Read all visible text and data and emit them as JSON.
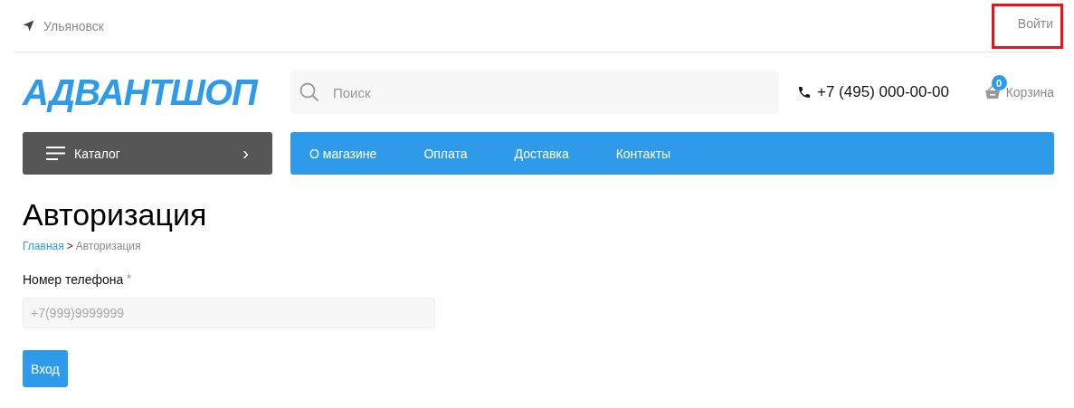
{
  "top_bar": {
    "city": "Ульяновск",
    "login": {
      "label": "Войти",
      "highlighted": true
    }
  },
  "header": {
    "logo": "АДВАНТШОП",
    "search": {
      "placeholder": "Поиск"
    },
    "phone": "+7 (495) 000-00-00",
    "cart": {
      "count": "0",
      "label": "Корзина"
    }
  },
  "catalog_button": {
    "label": "Каталог",
    "arrow": "›"
  },
  "menu": [
    {
      "label": "О магазине"
    },
    {
      "label": "Оплата"
    },
    {
      "label": "Доставка"
    },
    {
      "label": "Контакты"
    }
  ],
  "page_title": "Авторизация",
  "breadcrumbs": {
    "separator": ">",
    "items": [
      {
        "label": "Главная",
        "kind": "link"
      },
      {
        "label": "Авторизация",
        "kind": "current"
      }
    ]
  },
  "form": {
    "fields": [
      {
        "label": "Номер телефона",
        "required": true,
        "required_mark": "*",
        "placeholder": "+7(999)9999999"
      }
    ],
    "submit": "Вход"
  }
}
